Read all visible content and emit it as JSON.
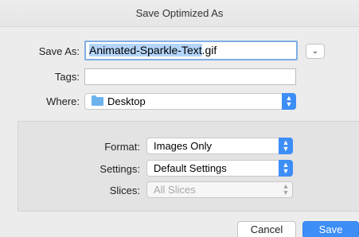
{
  "dialog": {
    "title": "Save Optimized As"
  },
  "save_as": {
    "label": "Save As:",
    "filename_selected": "Animated-Sparkle-Text",
    "filename_ext": ".gif",
    "expand_icon": "chevron-down-icon"
  },
  "tags": {
    "label": "Tags:",
    "value": ""
  },
  "where": {
    "label": "Where:",
    "value": "Desktop",
    "icon": "folder-icon"
  },
  "options": {
    "format": {
      "label": "Format:",
      "value": "Images Only"
    },
    "settings": {
      "label": "Settings:",
      "value": "Default Settings"
    },
    "slices": {
      "label": "Slices:",
      "value": "All Slices",
      "disabled": true
    }
  },
  "buttons": {
    "cancel": "Cancel",
    "save": "Save"
  },
  "colors": {
    "accent": "#3d8ef7",
    "selection": "#b4d4f8",
    "folder": "#6cb3ee"
  }
}
